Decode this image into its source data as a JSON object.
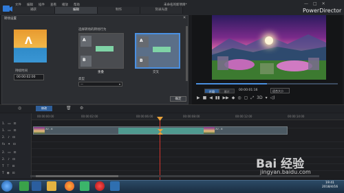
{
  "app": {
    "menu": [
      "文件",
      "编辑",
      "插件",
      "查看",
      "播放",
      "帮助"
    ],
    "title": "未命名的新项目*",
    "brand": "PowerDirector",
    "window_controls": [
      "—",
      "□",
      "✕"
    ]
  },
  "tabs": [
    {
      "label": "捕获",
      "active": false
    },
    {
      "label": "编辑",
      "active": true
    },
    {
      "label": "制作",
      "active": false
    },
    {
      "label": "刻录光盘",
      "active": false
    }
  ],
  "panel": {
    "title": "转场设置",
    "close": "✕",
    "duration_label": "持续时间",
    "duration_value": "00:00:02:00",
    "prompt": "选择转场的转场行为",
    "options": [
      {
        "label": "重叠",
        "selected": false,
        "a": "A",
        "b": "B"
      },
      {
        "label": "交叉",
        "selected": true,
        "a": "A",
        "b": "B"
      }
    ],
    "type_label": "类型",
    "type_value": "—",
    "confirm": "确定"
  },
  "preview": {
    "mode_tabs": [
      {
        "label": "片段",
        "active": true
      },
      {
        "label": "影片",
        "active": false
      }
    ],
    "timecode": "00:00:01:16",
    "fit": "适合大小",
    "progress": 0.5,
    "controls": [
      "▶",
      "■",
      "◀",
      "▮▮",
      "▶▶",
      "◆",
      "◎",
      "▢",
      "⤢",
      "3D",
      "▾",
      "◁)"
    ]
  },
  "timeline": {
    "toolbar_button": "修改",
    "ruler_ticks": [
      "00:00:00:00",
      "00:00:02:00",
      "00:00:04:00",
      "00:00:06:00",
      "00:00:08:00",
      "00:00:10:00",
      "00:00:12:00",
      "00:00:14:00"
    ],
    "tracks": [
      "1.",
      "1.",
      "2.",
      "2.",
      "fx",
      "2.",
      "2.",
      "T",
      "T"
    ],
    "clip1_label": "XV - 6",
    "clip2_label": "XV - 6"
  },
  "taskbar": {
    "time": "19:41",
    "date": "2018/4/16"
  },
  "watermark": {
    "main": "Bai 经验",
    "sub": "jingyan.baidu.com"
  },
  "colors": {
    "accent": "#4a90e2",
    "selection": "#4f9a90",
    "playhead": "#d8342c"
  }
}
